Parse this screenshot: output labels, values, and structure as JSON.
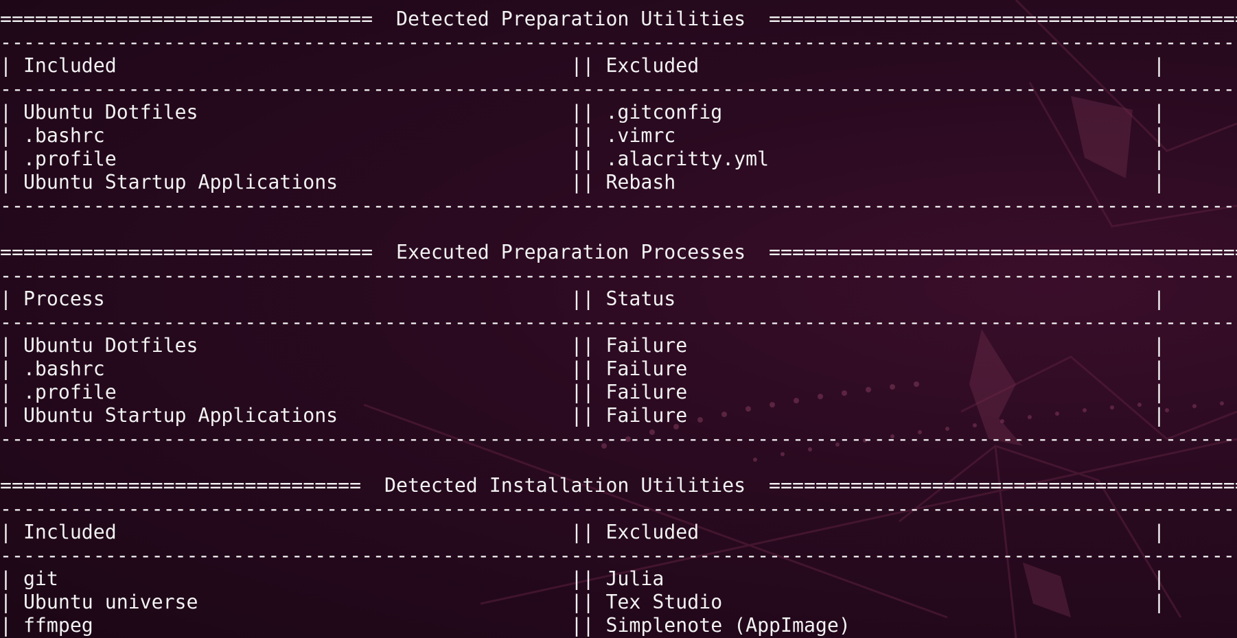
{
  "theme": {
    "background": "#2c0b22",
    "foreground": "#f2f2f2",
    "wallpaper_accent": "#6b2a4a"
  },
  "terminal": {
    "lines": [
      "================================  Detected Preparation Utilities  =================================================",
      "---------------------------------------------------------------------------------------------------------------------",
      "| Included                                       || Excluded                                       |",
      "---------------------------------------------------------------------------------------------------------------------",
      "| Ubuntu Dotfiles                                || .gitconfig                                     |",
      "| .bashrc                                        || .vimrc                                         |",
      "| .profile                                       || .alacritty.yml                                 |",
      "| Ubuntu Startup Applications                    || Rebash                                         |",
      "---------------------------------------------------------------------------------------------------------------------",
      "",
      "================================  Executed Preparation Processes  =================================================",
      "---------------------------------------------------------------------------------------------------------------------",
      "| Process                                        || Status                                         |",
      "---------------------------------------------------------------------------------------------------------------------",
      "| Ubuntu Dotfiles                                || Failure                                        |",
      "| .bashrc                                        || Failure                                        |",
      "| .profile                                       || Failure                                        |",
      "| Ubuntu Startup Applications                    || Failure                                        |",
      "---------------------------------------------------------------------------------------------------------------------",
      "",
      "===============================  Detected Installation Utilities  =================================================",
      "---------------------------------------------------------------------------------------------------------------------",
      "| Included                                       || Excluded                                       |",
      "---------------------------------------------------------------------------------------------------------------------",
      "| git                                            || Julia                                          |",
      "| Ubuntu universe                                || Tex Studio                                     |",
      "| ffmpeg                                         || Simplenote (AppImage)"
    ]
  }
}
